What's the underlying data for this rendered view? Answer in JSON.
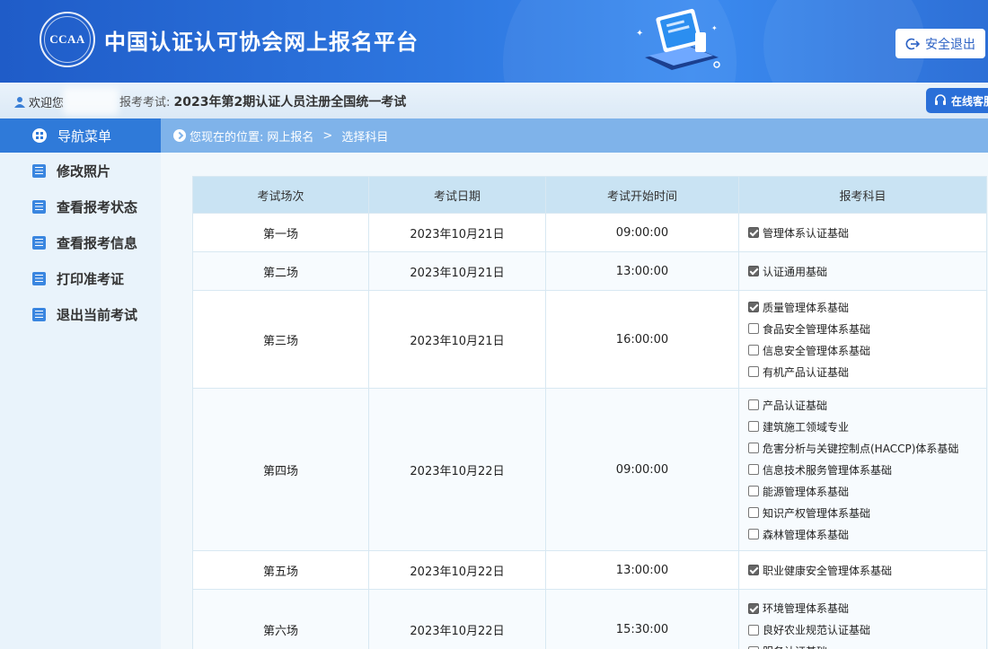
{
  "header": {
    "logo_text": "CCAA",
    "site_title": "中国认证认可协会网上报名平台",
    "logout_label": "安全退出"
  },
  "infobar": {
    "welcome_label": "欢迎您",
    "exam_prefix": "报考考试:",
    "exam_name": "2023年第2期认证人员注册全国统一考试",
    "service_label": "在线客服"
  },
  "sidebar": {
    "title": "导航菜单",
    "items": [
      {
        "label": "修改照片"
      },
      {
        "label": "查看报考状态"
      },
      {
        "label": "查看报考信息"
      },
      {
        "label": "打印准考证"
      },
      {
        "label": "退出当前考试"
      }
    ]
  },
  "breadcrumb": {
    "prefix": "您现在的位置:",
    "level1": "网上报名",
    "sep": ">",
    "level2": "选择科目"
  },
  "table": {
    "headers": [
      "考试场次",
      "考试日期",
      "考试开始时间",
      "报考科目"
    ],
    "rows": [
      {
        "session": "第一场",
        "date": "2023年10月21日",
        "time": "09:00:00",
        "subjects": [
          {
            "name": "管理体系认证基础",
            "checked": true
          }
        ]
      },
      {
        "session": "第二场",
        "date": "2023年10月21日",
        "time": "13:00:00",
        "subjects": [
          {
            "name": "认证通用基础",
            "checked": true
          }
        ]
      },
      {
        "session": "第三场",
        "date": "2023年10月21日",
        "time": "16:00:00",
        "subjects": [
          {
            "name": "质量管理体系基础",
            "checked": true
          },
          {
            "name": "食品安全管理体系基础",
            "checked": false
          },
          {
            "name": "信息安全管理体系基础",
            "checked": false
          },
          {
            "name": "有机产品认证基础",
            "checked": false
          }
        ]
      },
      {
        "session": "第四场",
        "date": "2023年10月22日",
        "time": "09:00:00",
        "subjects": [
          {
            "name": "产品认证基础",
            "checked": false
          },
          {
            "name": "建筑施工领域专业",
            "checked": false
          },
          {
            "name": "危害分析与关键控制点(HACCP)体系基础",
            "checked": false
          },
          {
            "name": "信息技术服务管理体系基础",
            "checked": false
          },
          {
            "name": "能源管理体系基础",
            "checked": false
          },
          {
            "name": "知识产权管理体系基础",
            "checked": false
          },
          {
            "name": "森林管理体系基础",
            "checked": false
          }
        ]
      },
      {
        "session": "第五场",
        "date": "2023年10月22日",
        "time": "13:00:00",
        "subjects": [
          {
            "name": "职业健康安全管理体系基础",
            "checked": true
          }
        ]
      },
      {
        "session": "第六场",
        "date": "2023年10月22日",
        "time": "15:30:00",
        "subjects": [
          {
            "name": "环境管理体系基础",
            "checked": true
          },
          {
            "name": "良好农业规范认证基础",
            "checked": false
          },
          {
            "name": "服务认证基础",
            "checked": false
          }
        ]
      }
    ]
  }
}
